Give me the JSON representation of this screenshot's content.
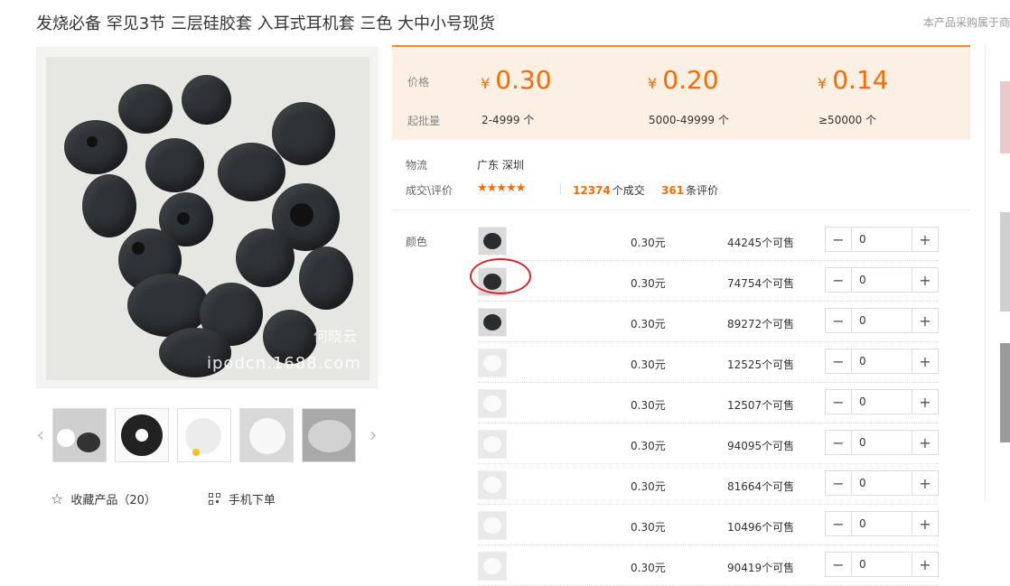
{
  "title": "发烧必备 罕见3节 三层硅胶套 入耳式耳机套 三色 大中小号现货",
  "top_note": "本产品采购属于商",
  "watermark": {
    "line1": "何晓云",
    "line2": "ipodcn.1688.com"
  },
  "actions": {
    "favorite": "收藏产品（20）",
    "mobile": "手机下单"
  },
  "price_panel": {
    "price_label": "价格",
    "moq_label": "起批量",
    "currency": "¥",
    "tiers": [
      {
        "price": "0.30",
        "range": "2-4999 个"
      },
      {
        "price": "0.20",
        "range": "5000-49999 个"
      },
      {
        "price": "0.14",
        "range": "≥50000 个"
      }
    ]
  },
  "logistics": {
    "label": "物流",
    "value": "广东 深圳"
  },
  "review": {
    "label": "成交\\评价",
    "stars": "★★★★★",
    "rating": 4.5,
    "deals": "12374",
    "deals_suffix": "个成交",
    "reviews": "361",
    "reviews_suffix": "条评价"
  },
  "sku": {
    "label": "颜色",
    "rows": [
      {
        "price": "0.30元",
        "stock": "44245个可售",
        "qty": "0",
        "swatch": "black"
      },
      {
        "price": "0.30元",
        "stock": "74754个可售",
        "qty": "0",
        "swatch": "black"
      },
      {
        "price": "0.30元",
        "stock": "89272个可售",
        "qty": "0",
        "swatch": "black"
      },
      {
        "price": "0.30元",
        "stock": "12525个可售",
        "qty": "0",
        "swatch": "white"
      },
      {
        "price": "0.30元",
        "stock": "12507个可售",
        "qty": "0",
        "swatch": "white"
      },
      {
        "price": "0.30元",
        "stock": "94095个可售",
        "qty": "0",
        "swatch": "white"
      },
      {
        "price": "0.30元",
        "stock": "81664个可售",
        "qty": "0",
        "swatch": "white"
      },
      {
        "price": "0.30元",
        "stock": "10496个可售",
        "qty": "0",
        "swatch": "white"
      },
      {
        "price": "0.30元",
        "stock": "90419个可售",
        "qty": "0",
        "swatch": "white"
      }
    ]
  },
  "colors": {
    "accent": "#ff6a00",
    "panel_bg": "#fcefe4",
    "annotation": "#d9262b"
  }
}
